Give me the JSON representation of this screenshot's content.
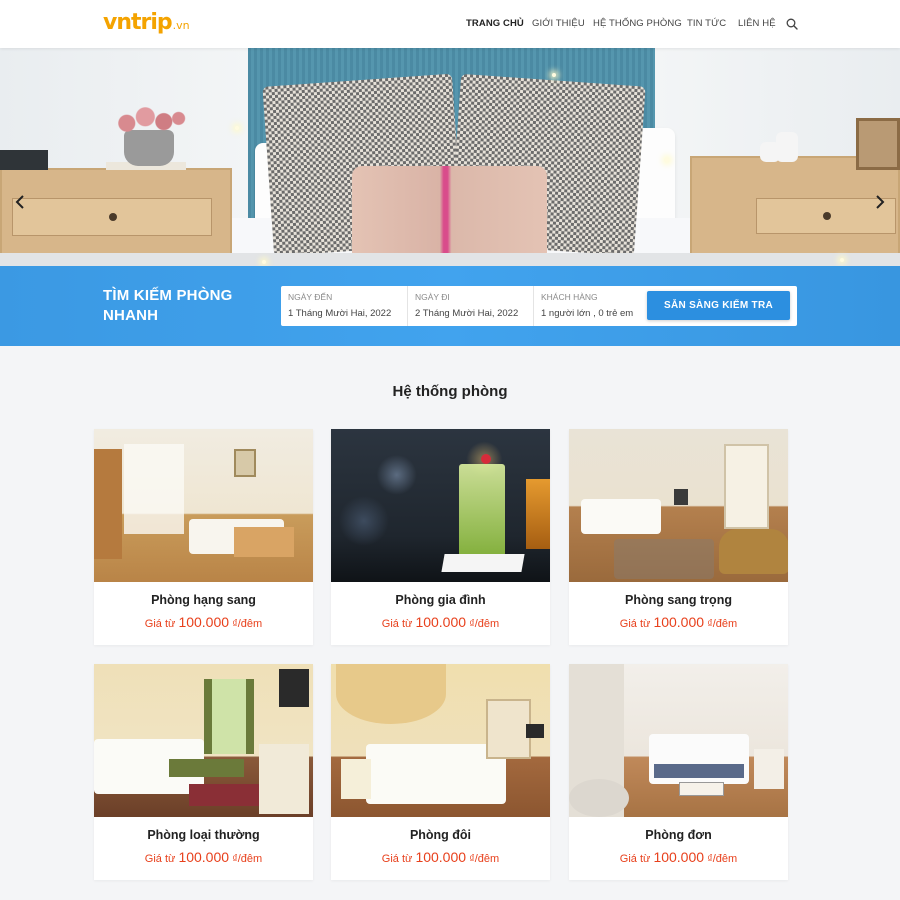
{
  "logo": {
    "brand_main": "vn",
    "brand_accent": "trip",
    "brand_tld": ".vn"
  },
  "nav": {
    "items": [
      {
        "label": "TRANG CHỦ",
        "active": true
      },
      {
        "label": "GIỚI THIỆU",
        "active": false
      },
      {
        "label": "HỆ THỐNG PHÒNG",
        "active": false
      },
      {
        "label": "TIN TỨC",
        "active": false
      },
      {
        "label": "LIÊN HỆ",
        "active": false
      }
    ],
    "search_icon": "search-icon"
  },
  "search": {
    "title": "TÌM KIẾM PHÒNG NHANH",
    "checkin_label": "NGÀY ĐẾN",
    "checkin_value": "1 Tháng Mười Hai, 2022",
    "checkout_label": "NGÀY ĐI",
    "checkout_value": "2 Tháng Mười Hai, 2022",
    "guests_label": "KHÁCH HÀNG",
    "guests_value": "1 người lớn , 0 trẻ em",
    "button_label": "SẴN SÀNG KIỂM TRA"
  },
  "rooms_section": {
    "title": "Hệ thống phòng",
    "price_prefix": "Giá từ",
    "price_suffix": "₫/đêm",
    "rooms": [
      {
        "name": "Phòng hạng sang",
        "price": "100.000"
      },
      {
        "name": "Phòng gia đình",
        "price": "100.000"
      },
      {
        "name": "Phòng sang trọng",
        "price": "100.000"
      },
      {
        "name": "Phòng loại thường",
        "price": "100.000"
      },
      {
        "name": "Phòng đôi",
        "price": "100.000"
      },
      {
        "name": "Phòng đơn",
        "price": "100.000"
      }
    ]
  },
  "colors": {
    "accent": "#f4a300",
    "primary_blue": "#3b99e3",
    "price_red": "#e8401c"
  }
}
